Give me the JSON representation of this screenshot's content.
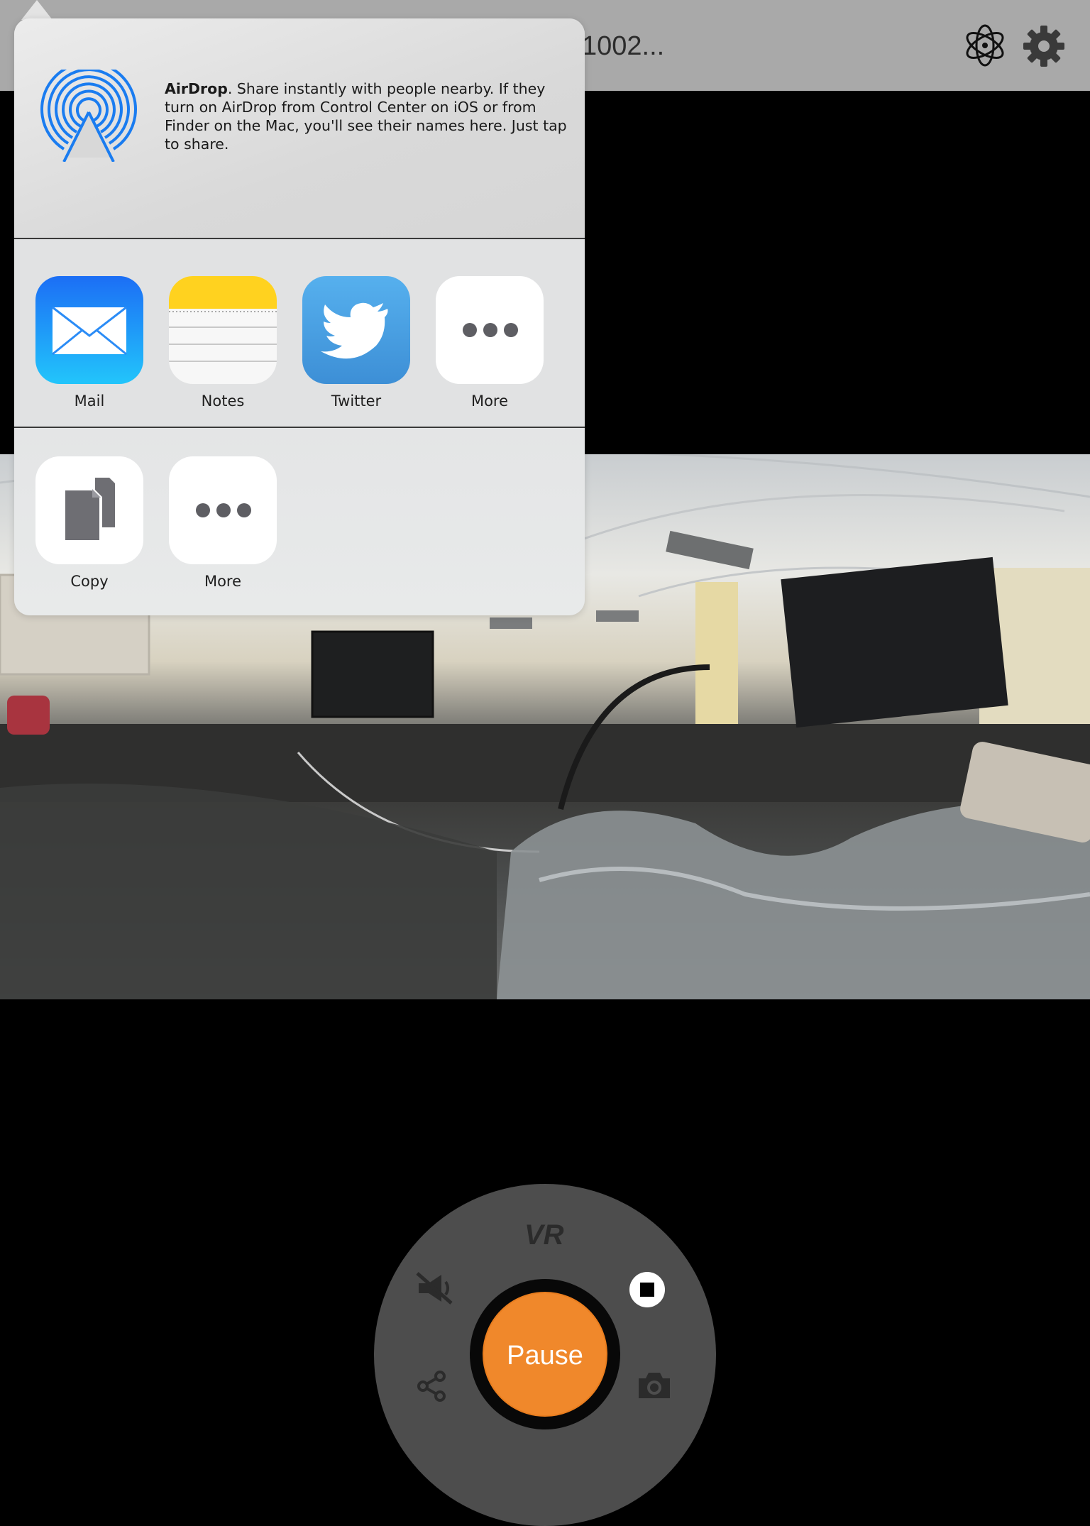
{
  "header": {
    "title": "1002...",
    "icons": [
      "atom-icon",
      "gear-icon"
    ]
  },
  "share_sheet": {
    "airdrop": {
      "heading": "AirDrop",
      "text": ". Share instantly with people nearby. If they turn on AirDrop from Control Center on iOS or from Finder on the Mac, you'll see their names here. Just tap to share."
    },
    "apps": [
      {
        "label": "Mail",
        "icon": "mail-icon"
      },
      {
        "label": "Notes",
        "icon": "notes-icon"
      },
      {
        "label": "Twitter",
        "icon": "twitter-icon"
      },
      {
        "label": "More",
        "icon": "more-icon"
      }
    ],
    "actions": [
      {
        "label": "Copy",
        "icon": "copy-icon"
      },
      {
        "label": "More",
        "icon": "more-icon"
      }
    ]
  },
  "controls": {
    "mode_label": "VR",
    "pause_label": "Pause",
    "icons": [
      "mute-icon",
      "stop-icon",
      "share-icon",
      "camera-icon"
    ]
  },
  "colors": {
    "accent": "#f0882b",
    "mail_blue": "#1e8ff7",
    "twitter_blue": "#4aa3e6",
    "notes_yellow": "#ffd21f"
  }
}
